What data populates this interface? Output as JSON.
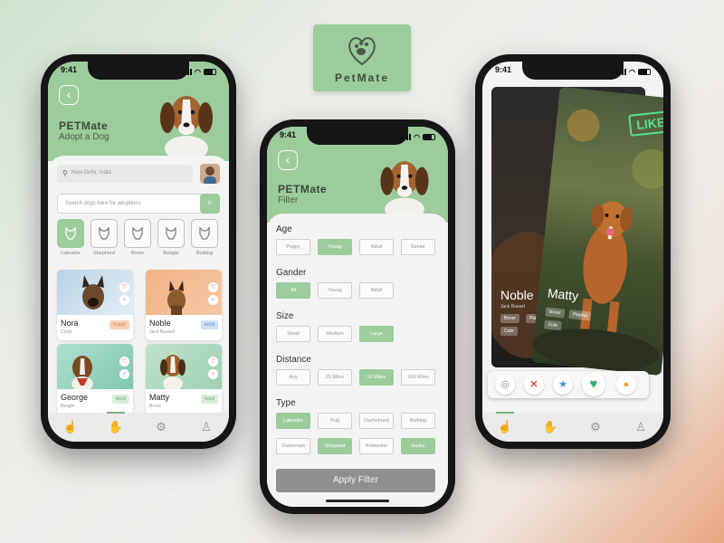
{
  "status_time": "9:41",
  "logo": {
    "text": "PetMate"
  },
  "phone1": {
    "brand": "PETMate",
    "subtitle": "Adopt a Dog",
    "location_placeholder": "New Delhi, India",
    "search_placeholder": "Search dogs here for adoptions",
    "breeds": [
      "Labrador",
      "Shepherd",
      "Boxer",
      "Beagle",
      "Bulldog"
    ],
    "pets": [
      {
        "name": "Nora",
        "breed": "Corgi",
        "tag": "Puppy",
        "gender": "female"
      },
      {
        "name": "Noble",
        "breed": "Jack Russell",
        "tag": "Adult",
        "gender": "female"
      },
      {
        "name": "George",
        "breed": "Beagle",
        "tag": "Adult",
        "gender": "male"
      },
      {
        "name": "Matty",
        "breed": "Boxer",
        "tag": "Adult",
        "gender": "female"
      }
    ]
  },
  "phone2": {
    "brand": "PETMate",
    "subtitle": "Filter",
    "sections": {
      "age": {
        "title": "Age",
        "options": [
          "Puppy",
          "Young",
          "Adult",
          "Senior"
        ],
        "selected": "Young"
      },
      "gender": {
        "title": "Gander",
        "options": [
          "All",
          "Young",
          "Adult"
        ],
        "selected": "All"
      },
      "size": {
        "title": "Size",
        "options": [
          "Small",
          "Medium",
          "Large"
        ],
        "selected": "Large"
      },
      "distance": {
        "title": "Distance",
        "options": [
          "Any",
          "25 Miles",
          "50 Miles",
          "100 Miles"
        ],
        "selected": "50 Miles"
      },
      "type": {
        "title": "Type",
        "options": [
          "Labrador",
          "Pug",
          "Dachshund",
          "Bulldog",
          "Doberman",
          "Sharpard",
          "Rottweiler",
          "Husky"
        ],
        "selected": [
          "Labrador",
          "Sharpard",
          "Husky"
        ]
      }
    },
    "apply_label": "Apply Filter"
  },
  "phone3": {
    "like_label": "LIKE",
    "back_card": {
      "name": "Noble",
      "breed": "Jack Russel",
      "chips": [
        "Boxer",
        "Playing",
        "Cute"
      ]
    },
    "front_card": {
      "name": "Matty",
      "chips": [
        "Boxer",
        "Playing",
        "Cute"
      ]
    }
  },
  "colors": {
    "accent": "#9ccb9c",
    "dark": "#161616",
    "like": "#58e08a"
  }
}
